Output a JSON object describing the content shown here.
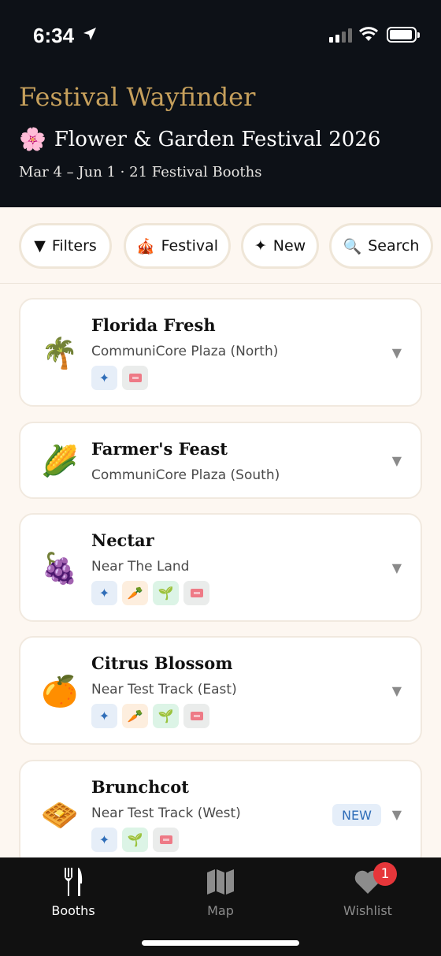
{
  "status": {
    "time": "6:34"
  },
  "header": {
    "app_title": "Festival Wayfinder",
    "festival_icon": "🌸",
    "festival_name": "Flower & Garden Festival 2026",
    "subtitle": "Mar 4 – Jun 1 · 21 Festival Booths"
  },
  "filters": [
    {
      "icon": "▼",
      "label": "Filters"
    },
    {
      "icon": "🎪",
      "label": "Festival"
    },
    {
      "icon": "✦",
      "label": "New"
    },
    {
      "icon": "🔍",
      "label": "Search"
    }
  ],
  "booths": [
    {
      "emoji": "🌴",
      "name": "Florida Fresh",
      "location": "CommuniCore Plaza (North)",
      "tags": [
        "new-item",
        "ticket"
      ],
      "new": false
    },
    {
      "emoji": "🌽",
      "name": "Farmer's Feast",
      "location": "CommuniCore Plaza (South)",
      "tags": [],
      "new": false
    },
    {
      "emoji": "🍇",
      "name": "Nectar",
      "location": "Near The Land",
      "tags": [
        "new-item",
        "vegetarian",
        "plant-based",
        "ticket"
      ],
      "new": false
    },
    {
      "emoji": "🍊",
      "name": "Citrus Blossom",
      "location": "Near Test Track (East)",
      "tags": [
        "new-item",
        "vegetarian",
        "plant-based",
        "ticket"
      ],
      "new": false
    },
    {
      "emoji": "🧇",
      "name": "Brunchcot",
      "location": "Near Test Track (West)",
      "tags": [
        "new-item",
        "plant-based",
        "ticket"
      ],
      "new": true,
      "new_label": "NEW"
    }
  ],
  "tabs": [
    {
      "label": "Booths",
      "active": true
    },
    {
      "label": "Map",
      "active": false
    },
    {
      "label": "Wishlist",
      "active": false,
      "badge": "1"
    }
  ],
  "colors": {
    "header_bg": "#0d1117",
    "accent_gold": "#c6a05c",
    "page_bg": "#fdf7f1",
    "badge_red": "#e6363a"
  }
}
